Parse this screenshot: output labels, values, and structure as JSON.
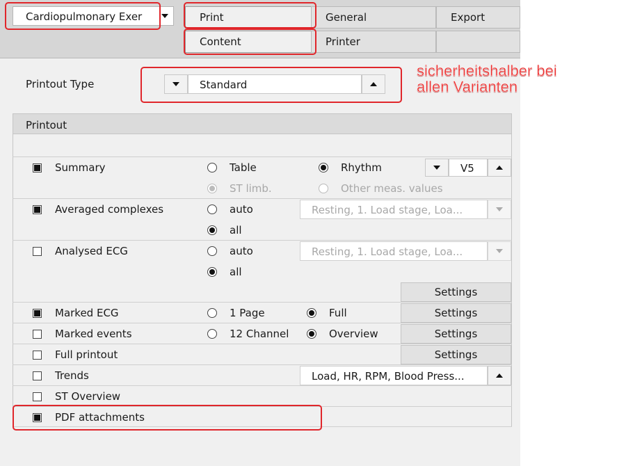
{
  "header": {
    "profile_select": "Cardiopulmonary Exer",
    "tabs_row1": [
      "Print",
      "General",
      "Export"
    ],
    "tabs_row2": [
      "Content",
      "Printer"
    ]
  },
  "printout_type": {
    "label": "Printout Type",
    "value": "Standard"
  },
  "annotation": {
    "line1": "sicherheitshalber bei",
    "line2": "allen Varianten"
  },
  "printout": {
    "header": "Printout",
    "summary": {
      "label": "Summary",
      "checked": true,
      "opt_table": "Table",
      "opt_rhythm": "Rhythm",
      "lead": "V5",
      "opt_st_limb": "ST limb.",
      "opt_other": "Other meas. values"
    },
    "averaged": {
      "label": "Averaged complexes",
      "checked": true,
      "opt_auto": "auto",
      "opt_all": "all",
      "stages": "Resting, 1. Load stage, Loa..."
    },
    "analysed": {
      "label": "Analysed ECG",
      "checked": false,
      "opt_auto": "auto",
      "opt_all": "all",
      "stages": "Resting, 1. Load stage, Loa...",
      "settings": "Settings"
    },
    "marked_ecg": {
      "label": "Marked ECG",
      "checked": true,
      "opt_1page": "1 Page",
      "opt_full": "Full",
      "settings": "Settings"
    },
    "marked_events": {
      "label": "Marked events",
      "checked": false,
      "opt_12ch": "12 Channel",
      "opt_overview": "Overview",
      "settings": "Settings"
    },
    "full_printout": {
      "label": "Full printout",
      "checked": false,
      "settings": "Settings"
    },
    "trends": {
      "label": "Trends",
      "checked": false,
      "value": "Load, HR, RPM, Blood Press..."
    },
    "st_overview": {
      "label": "ST Overview",
      "checked": false
    },
    "pdf": {
      "label": "PDF attachments",
      "checked": true
    }
  },
  "colors": {
    "highlight": "#e0262b",
    "annotation": "#ee2a2a"
  }
}
